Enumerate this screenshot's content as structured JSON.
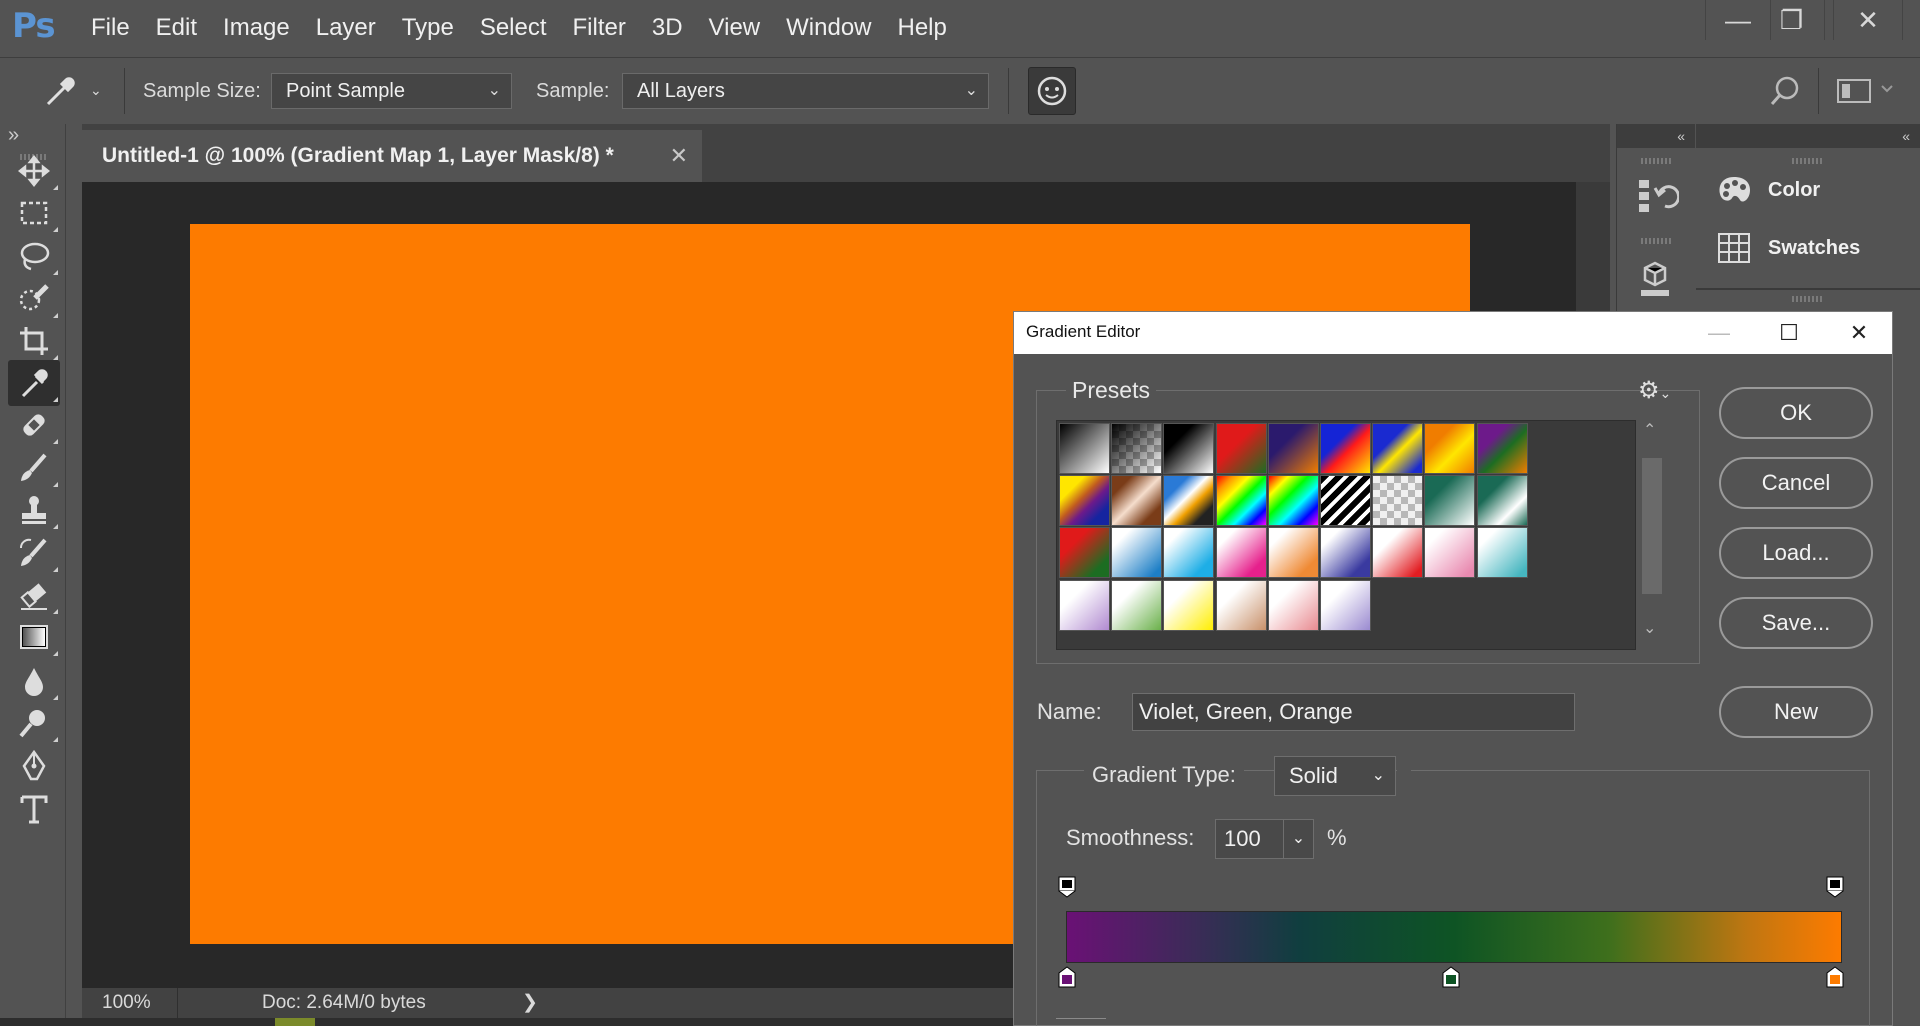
{
  "app": {
    "logo": "Ps"
  },
  "menu": [
    "File",
    "Edit",
    "Image",
    "Layer",
    "Type",
    "Select",
    "Filter",
    "3D",
    "View",
    "Window",
    "Help"
  ],
  "window_controls": {
    "minimize": "—",
    "restore": "❐",
    "close": "✕"
  },
  "options": {
    "sample_size_label": "Sample Size:",
    "sample_size_value": "Point Sample",
    "sample_label": "Sample:",
    "sample_value": "All Layers"
  },
  "panel_toggles": {
    "left": "»",
    "right_narrow": "«",
    "right_wide": "«"
  },
  "document": {
    "tab_title": "Untitled-1 @ 100% (Gradient Map 1, Layer Mask/8) *",
    "tab_close": "✕",
    "canvas_color": "#fd7b00"
  },
  "status": {
    "zoom": "100%",
    "doc_info": "Doc: 2.64M/0 bytes",
    "arrow": "❯"
  },
  "panels": {
    "color": "Color",
    "swatches": "Swatches"
  },
  "gradient_editor": {
    "title": "Gradient Editor",
    "minimize": "—",
    "maximize": "☐",
    "close": "✕",
    "presets_label": "Presets",
    "gear": "⚙",
    "buttons": {
      "ok": "OK",
      "cancel": "Cancel",
      "load": "Load...",
      "save": "Save...",
      "new": "New"
    },
    "name_label": "Name:",
    "name_value": "Violet, Green, Orange",
    "gradient_type_label": "Gradient Type:",
    "gradient_type_value": "Solid",
    "smoothness_label": "Smoothness:",
    "smoothness_value": "100",
    "percent": "%",
    "color_stops": [
      "#6a1175",
      "#0e5424",
      "#fd7b00"
    ],
    "presets": [
      "linear-gradient(135deg,#000 0%,#fff 100%)",
      "linear-gradient(135deg,#000 0%,transparent 100%),repeating-conic-gradient(#bbb 0 25%,#fff 0 50%) 0 0/14px 14px",
      "linear-gradient(135deg,#000 30%,#fff 100%)",
      "linear-gradient(135deg,#e01a1a 40%,#1c6d22 100%)",
      "linear-gradient(135deg,#2b1a6d 35%,#f07d00 100%)",
      "linear-gradient(135deg,#1524d6 35%,#ff1a1a 55%,#ffe600 100%)",
      "linear-gradient(135deg,#1a2ad0 35%,#ffe600 55%,#1a2ad0 90%)",
      "linear-gradient(135deg,#f07d00 30%,#ffe600 60%,#f07d00 100%)",
      "linear-gradient(135deg,#6d1a8a 30%,#1c6d22 55%,#f07d00 100%)",
      "linear-gradient(135deg,#ffe600 25%,#c05a20 45%,#6d1a8a 60%,#1524a0 80%)",
      "linear-gradient(135deg,#7a3c18 20%,#f5ddcc 50%,#7a3c18 80%)",
      "linear-gradient(135deg,#2a7ad6 25%,#ffffff 45%,#f0a000 60%,#222 80%)",
      "linear-gradient(135deg,#ff0000,#ff9900,#ffff00,#00ff00,#00ffff,#0000ff,#ff00ff)",
      "linear-gradient(135deg,#ff0000,#ffff00,#00ff00,#00ffff,#0000ff,#ff00ff),repeating-conic-gradient(#bbb 0 25%,#fff 0 50%) 0 0/14px 14px",
      "repeating-linear-gradient(135deg,#000 0 6px,#fff 6px 10px)",
      "repeating-conic-gradient(#b8b8b8 0 25%,#f0f0f0 0 50%) 0 0/14px 14px",
      "linear-gradient(135deg,#1a6a55 30%,#ffffff 100%)",
      "linear-gradient(135deg,#1a6a55 30%,#ffffff 70%,#1a6a55 100%)",
      "linear-gradient(135deg,#e01a1a 30%,#1c6d22 80%)",
      "linear-gradient(135deg,#ffffff 20%,#1d7fc6 90%)",
      "linear-gradient(135deg,#ffffff 20%,#1eaee6 80%)",
      "linear-gradient(135deg,#ffffff 20%,#e6208c 80%)",
      "linear-gradient(135deg,#ffffff 20%,#ef8a35 80%)",
      "linear-gradient(135deg,#ffffff 20%,#3a3aa0 80%)",
      "linear-gradient(135deg,#ffffff 30%,#e21d22 90%)",
      "linear-gradient(135deg,#ffffff 20%,#e98ab0 90%)",
      "linear-gradient(135deg,#ffffff 20%,#46b6c0 90%)",
      "linear-gradient(135deg,#ffffff 30%,#b08ad0 100%)",
      "linear-gradient(135deg,#ffffff 30%,#6ab04a 100%)",
      "linear-gradient(135deg,#ffffff 30%,#ffee00 100%)",
      "linear-gradient(135deg,#ffffff 30%,#c8906a 100%)",
      "linear-gradient(135deg,#ffffff 30%,#e88a90 100%)",
      "linear-gradient(135deg,#ffffff 30%,#9a8ad0 100%)"
    ]
  },
  "tools": [
    "move",
    "marquee",
    "lasso",
    "quick-selection",
    "crop",
    "eyedropper",
    "healing-brush",
    "brush",
    "clone-stamp",
    "history-brush",
    "eraser",
    "gradient",
    "blur",
    "dodge",
    "pen",
    "type"
  ]
}
